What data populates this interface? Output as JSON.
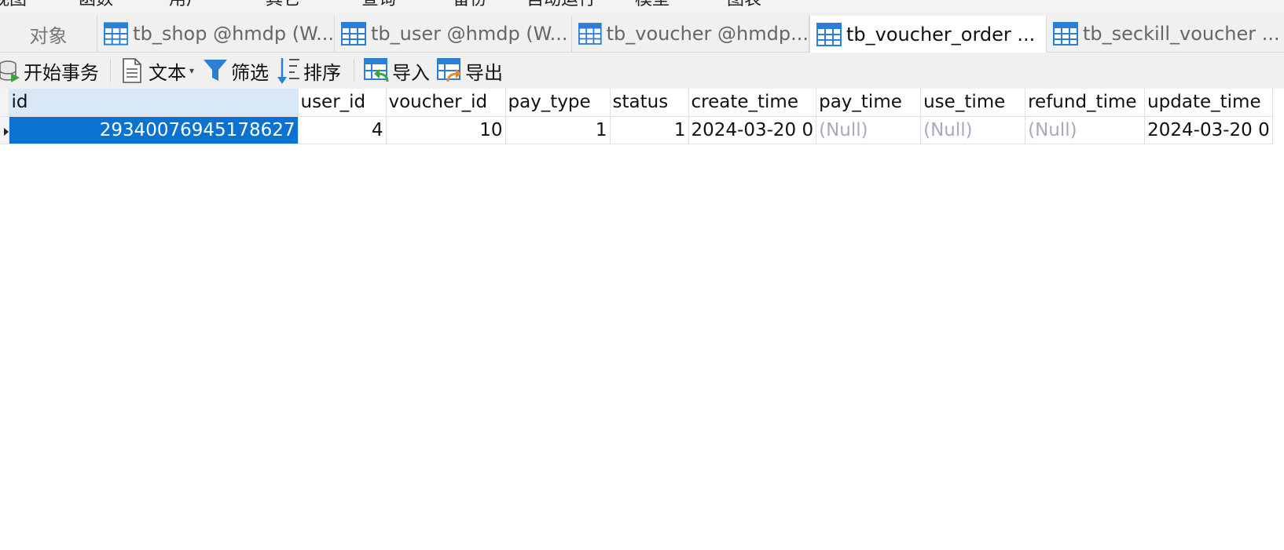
{
  "menubar": {
    "items": [
      "视图",
      "函数",
      "用户",
      "其它",
      "查询",
      "备份",
      "自动运行",
      "模型",
      "图表"
    ]
  },
  "tabs": [
    {
      "label": "对象",
      "icon": "objects-tab"
    },
    {
      "label": "tb_shop @hmdp (W...",
      "icon": "table-icon"
    },
    {
      "label": "tb_user @hmdp (W...",
      "icon": "table-icon"
    },
    {
      "label": "tb_voucher @hmdp...",
      "icon": "table-icon"
    },
    {
      "label": "tb_voucher_order ...",
      "icon": "table-icon",
      "active": true
    },
    {
      "label": "tb_seckill_voucher ...",
      "icon": "table-icon"
    }
  ],
  "toolbar": {
    "begin_transaction": "开始事务",
    "text": "文本",
    "filter": "筛选",
    "sort": "排序",
    "import": "导入",
    "export": "导出"
  },
  "grid": {
    "columns": [
      "id",
      "user_id",
      "voucher_id",
      "pay_type",
      "status",
      "create_time",
      "pay_time",
      "use_time",
      "refund_time",
      "update_time"
    ],
    "rows": [
      {
        "id": "29340076945178627",
        "user_id": "4",
        "voucher_id": "10",
        "pay_type": "1",
        "status": "1",
        "create_time": "2024-03-20 0",
        "pay_time": "(Null)",
        "use_time": "(Null)",
        "refund_time": "(Null)",
        "update_time": "2024-03-20 0"
      }
    ]
  },
  "colors": {
    "selection": "#0b72d1",
    "selected_header": "#d9e8f7",
    "null_text": "#a8a8c0",
    "tab_icon": "#2b7fd4"
  }
}
